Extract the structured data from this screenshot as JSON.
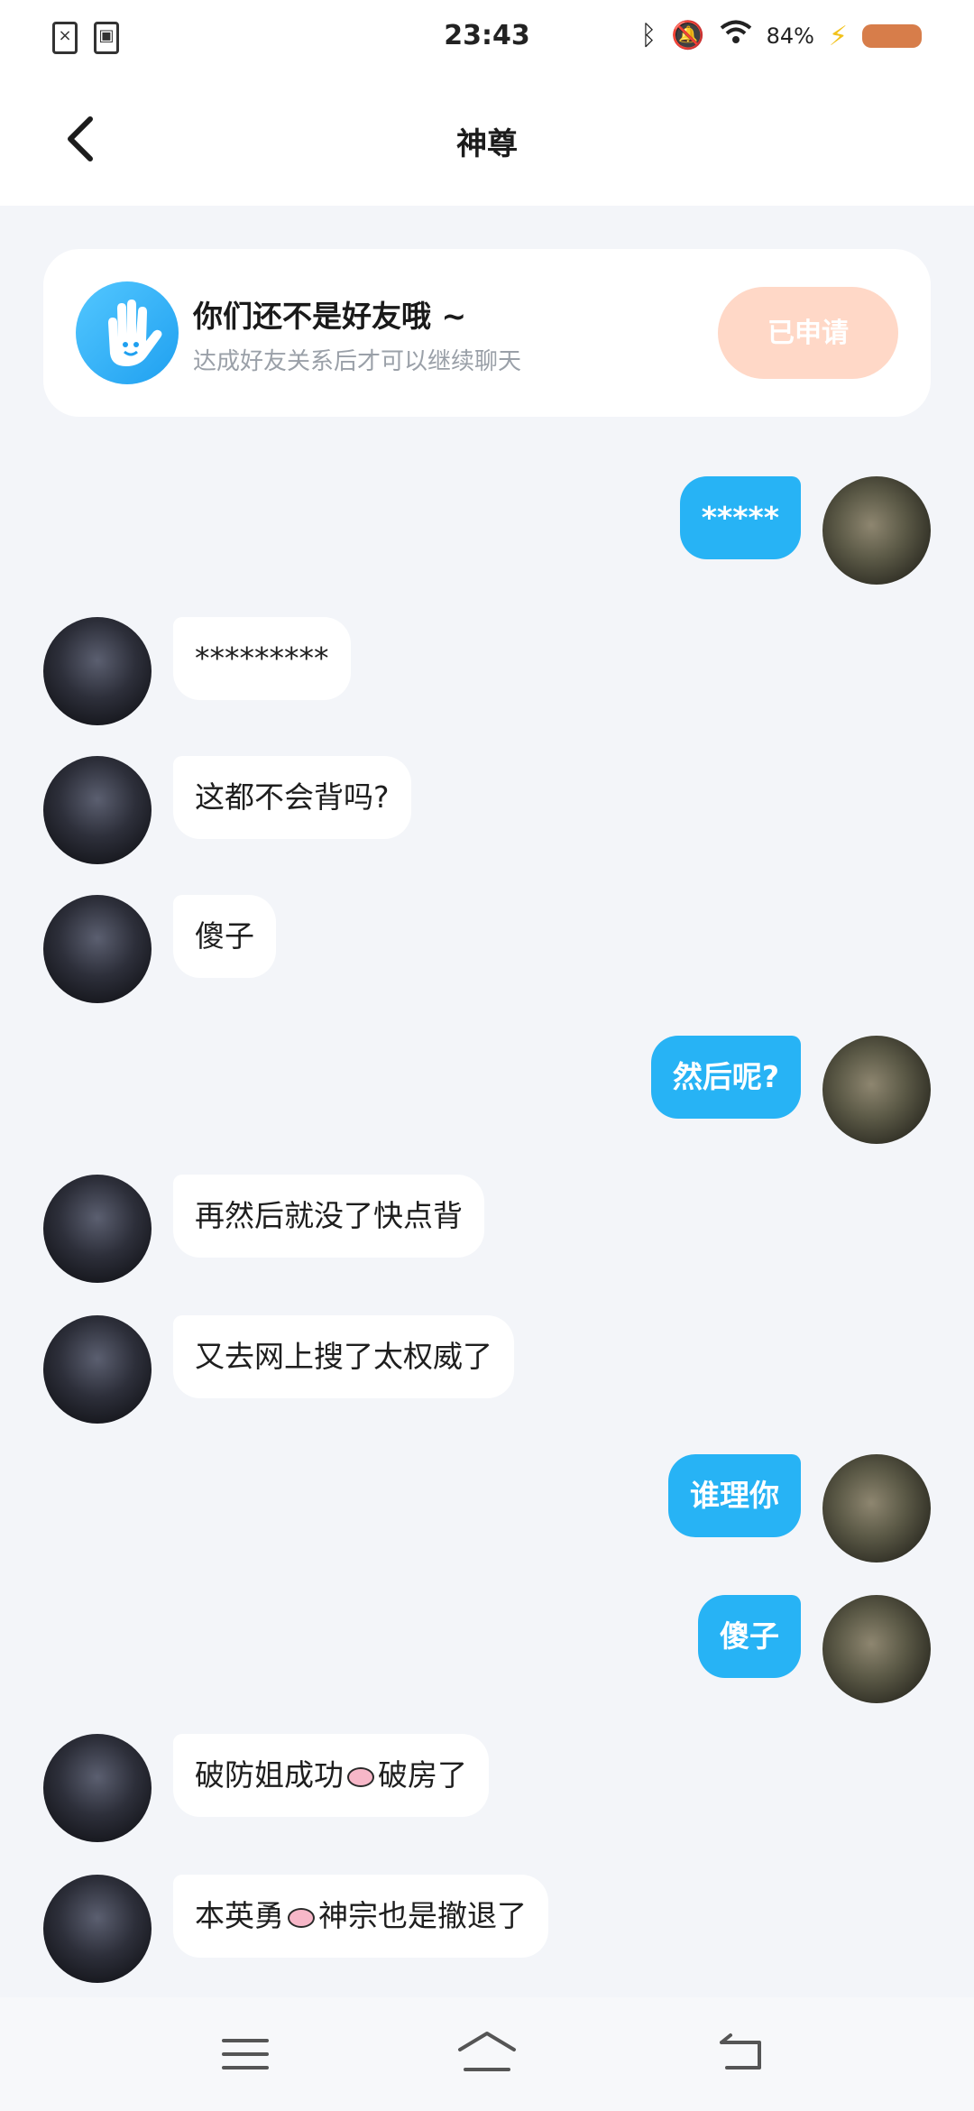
{
  "status_bar": {
    "time": "23:43",
    "battery_percent": "84%",
    "icons": [
      "sim-error-icon",
      "gallery-icon",
      "bluetooth-icon",
      "mute-icon",
      "wifi-icon",
      "charging-icon",
      "battery-icon"
    ],
    "battery_color": "#d77d4a"
  },
  "header": {
    "title": "神尊",
    "back_icon": "chevron-left-icon"
  },
  "notice": {
    "title": "你们还不是好友哦 ~",
    "subtitle": "达成好友关系后才可以继续聊天",
    "button_label": "已申请",
    "icon": "waving-hand-icon"
  },
  "messages": [
    {
      "side": "right",
      "text": "*****"
    },
    {
      "side": "left",
      "text": "*********"
    },
    {
      "side": "left",
      "text": "这都不会背吗?"
    },
    {
      "side": "left",
      "text": "傻子"
    },
    {
      "side": "right",
      "text": "然后呢?"
    },
    {
      "side": "left",
      "text": "再然后就没了快点背"
    },
    {
      "side": "left",
      "text": "又去网上搜了太权威了"
    },
    {
      "side": "right",
      "text": "谁理你"
    },
    {
      "side": "right",
      "text": "傻子"
    },
    {
      "side": "left",
      "text_before": "破防姐成功",
      "emoji": "lips-emoji",
      "text_after": "破房了"
    },
    {
      "side": "left",
      "text_before": "本英勇",
      "emoji": "lips-emoji",
      "text_after": "神宗也是撤退了"
    }
  ],
  "colors": {
    "accent_blue": "#27b3f5",
    "applied_button": "#ffd8c7",
    "chat_background": "#f3f5f9"
  },
  "navbar": {
    "icons": [
      "menu-icon",
      "home-icon",
      "back-icon"
    ]
  }
}
